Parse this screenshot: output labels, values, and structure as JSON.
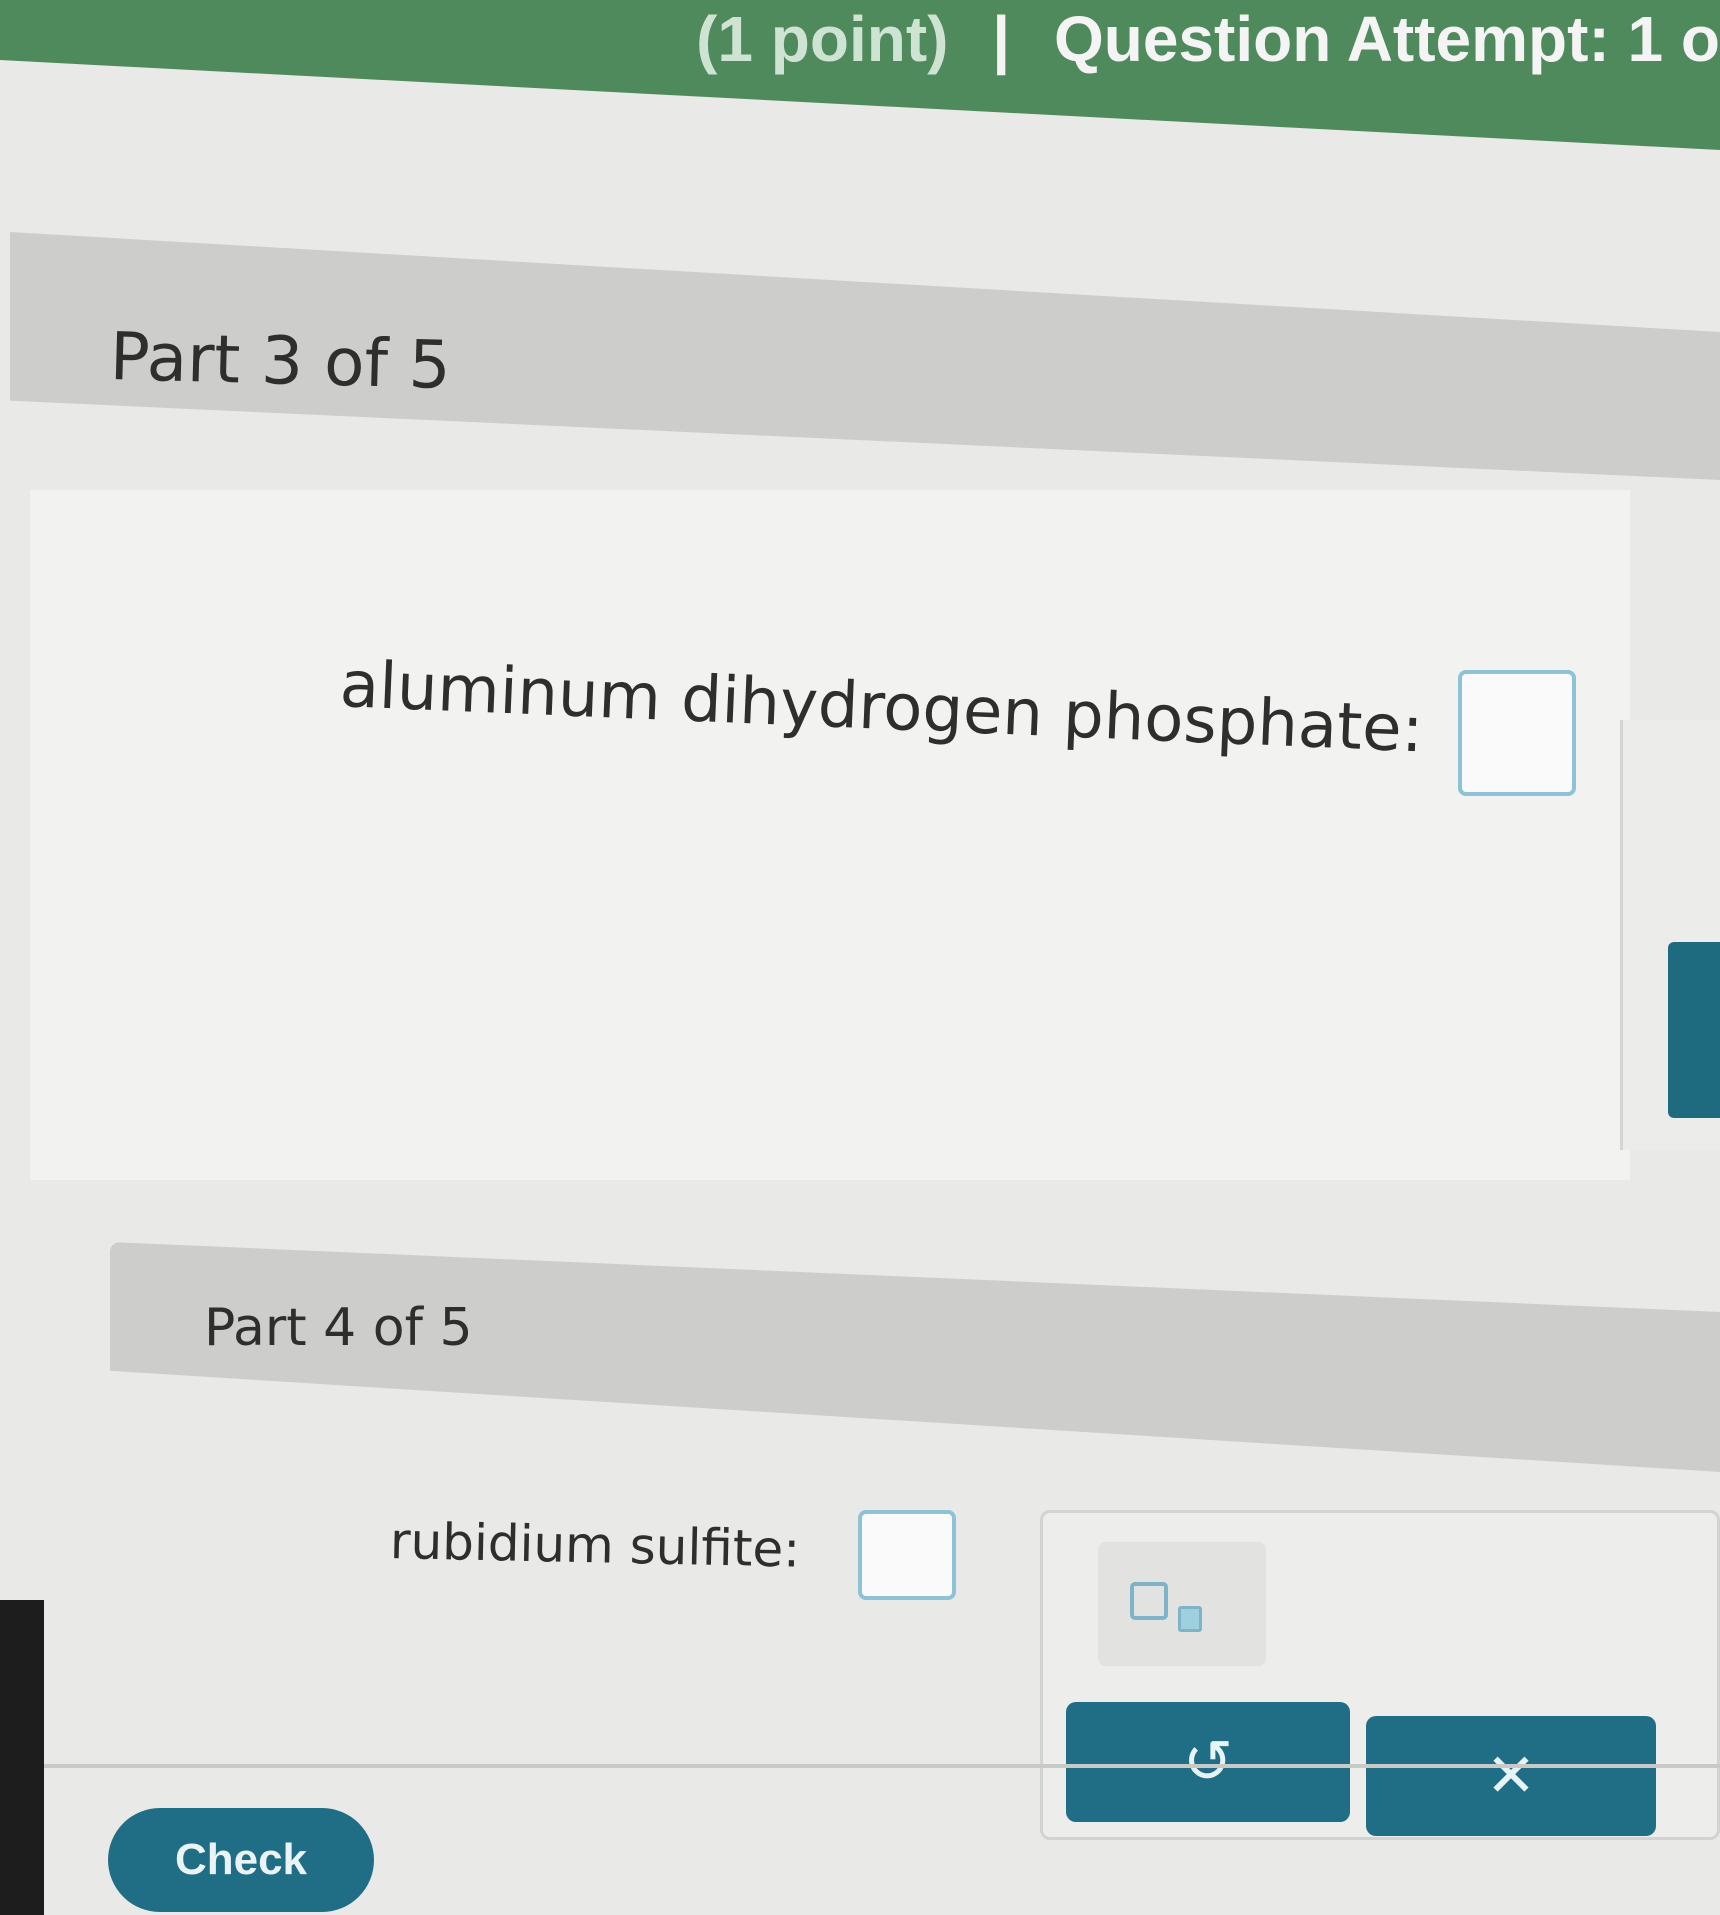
{
  "header": {
    "points_text": "(1 point)",
    "separator": "|",
    "attempt_text": "Question Attempt: 1 o"
  },
  "part3": {
    "title": "Part 3 of 5",
    "question_label": "aluminum dihydrogen phosphate:",
    "answer_value": ""
  },
  "part4": {
    "title": "Part 4 of 5",
    "question_label": "rubidium sulfite:",
    "answer_value": ""
  },
  "toolbar": {
    "undo_glyph": "↺",
    "clear_glyph": "✕"
  },
  "footer": {
    "check_label": "Check"
  },
  "colors": {
    "header_green": "#4f8a5d",
    "accent_teal": "#1f6e86",
    "input_border": "#8cc3d6"
  }
}
